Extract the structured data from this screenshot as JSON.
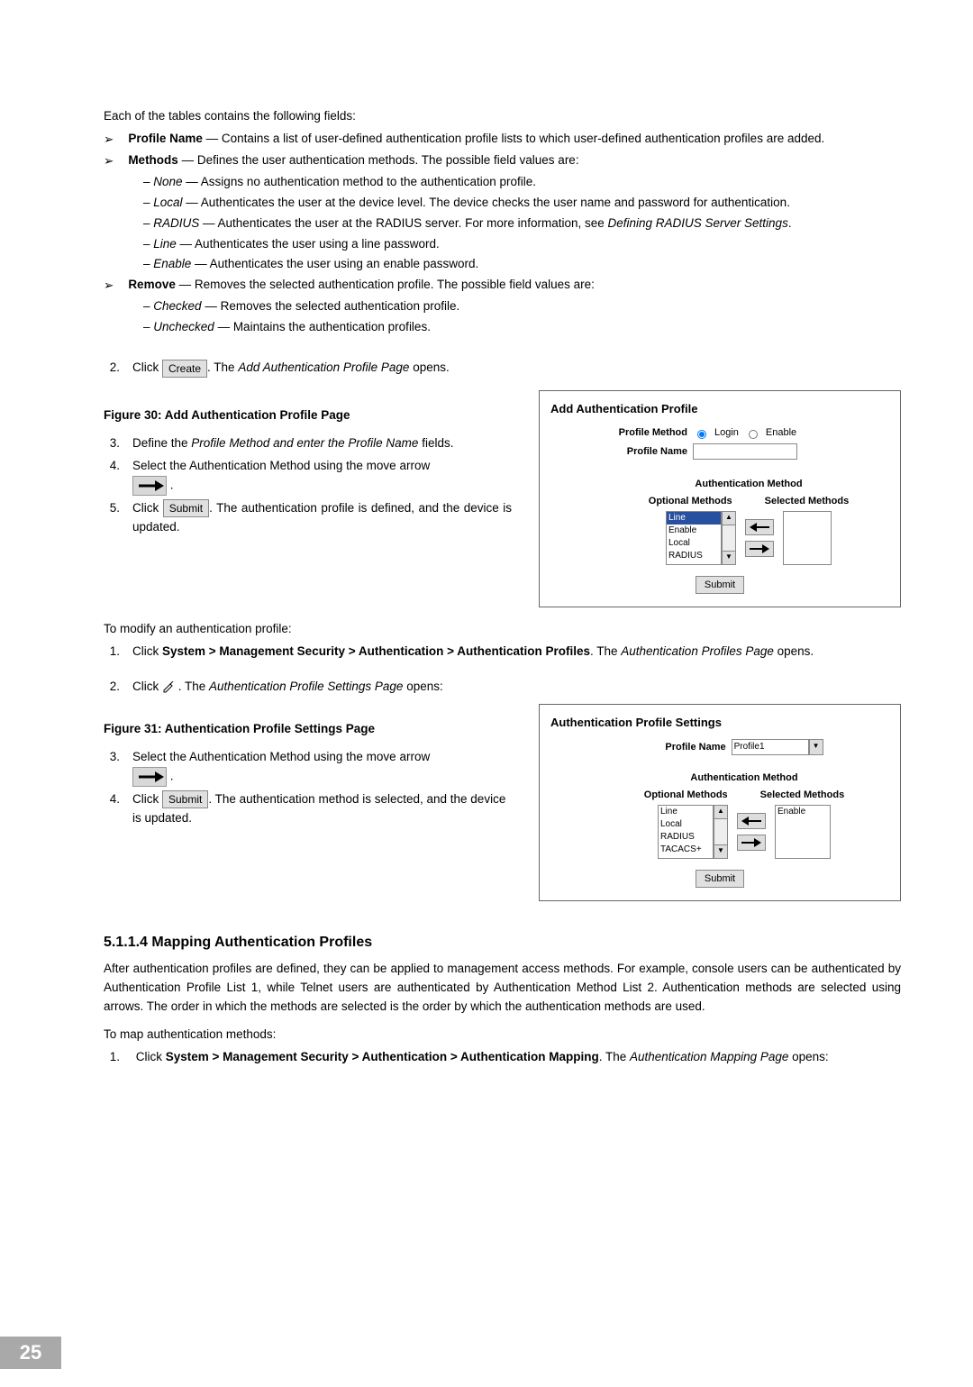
{
  "intro": "Each of the tables contains the following fields:",
  "bullets": {
    "profile_name": {
      "label": "Profile Name",
      "desc": " — Contains a list of user-defined authentication profile lists to which user-defined authentication profiles are added."
    },
    "methods": {
      "label": "Methods",
      "desc": " — Defines the user authentication methods. The possible field values are:"
    },
    "methods_sub": [
      {
        "em": "None",
        "rest": " — Assigns no authentication method to the authentication profile."
      },
      {
        "em": "Local",
        "rest": " — Authenticates the user at the device level. The device checks the user name and password for authentication."
      },
      {
        "em": "RADIUS",
        "rest": " — Authenticates the user at the RADIUS server. For more information, see ",
        "em2": "Defining RADIUS Server Settings",
        "tail": "."
      },
      {
        "em": "Line",
        "rest": " — Authenticates the user using a line password."
      },
      {
        "em": "Enable",
        "rest": " — Authenticates the user using an enable password."
      }
    ],
    "remove": {
      "label": "Remove",
      "desc": " — Removes the selected authentication profile. The possible field values are:"
    },
    "remove_sub": [
      {
        "em": "Checked",
        "rest": " — Removes the selected authentication profile."
      },
      {
        "em": "Unchecked",
        "rest": " — Maintains the authentication profiles."
      }
    ]
  },
  "step2": {
    "pre": "Click ",
    "btn": "Create",
    "post": ". The ",
    "em": "Add Authentication Profile Page",
    "tail": " opens."
  },
  "fig30_title": "Figure 30: Add Authentication Profile Page",
  "step3": "Define the ",
  "step3_em": "Profile Method and enter the Profile Name",
  "step3_tail": " fields.",
  "step4": "Select the Authentication Method using the move arrow ",
  "step5": {
    "pre": "Click ",
    "btn": "Submit",
    "post": ". The authentication profile is defined, and the device is updated."
  },
  "dlg1": {
    "title": "Add Authentication Profile",
    "profile_method_label": "Profile Method",
    "login": "Login",
    "enable": "Enable",
    "profile_name_label": "Profile Name",
    "auth_header": "Authentication Method",
    "optional": "Optional Methods",
    "selected": "Selected Methods",
    "opts": [
      "Line",
      "Enable",
      "Local",
      "RADIUS"
    ],
    "submit": "Submit"
  },
  "modify_intro": "To modify an authentication profile:",
  "m1": {
    "pre": "Click ",
    "bold": "System > Management Security > Authentication > Authentication Profiles",
    "post": ". The ",
    "em": "Authentication Profiles Page",
    "tail": " opens."
  },
  "m2": {
    "pre": "Click ",
    "post": " . The ",
    "em": "Authentication Profile Settings Page",
    "tail": " opens:"
  },
  "fig31_title": "Figure 31: Authentication Profile Settings Page",
  "s3": "Select the Authentication Method using the move arrow ",
  "s4": {
    "pre": "Click ",
    "btn": "Submit",
    "post": ". The authentication method is selected, and the device is updated."
  },
  "dlg2": {
    "title": "Authentication Profile Settings",
    "profile_name_label": "Profile Name",
    "profile_name_value": "Profile1",
    "auth_header": "Authentication Method",
    "optional": "Optional Methods",
    "selected": "Selected Methods",
    "opts": [
      "Line",
      "Local",
      "RADIUS",
      "TACACS+"
    ],
    "sel_opts": [
      "Enable"
    ],
    "submit": "Submit"
  },
  "section_head": "5.1.1.4   Mapping Authentication Profiles",
  "section_body": "After authentication profiles are defined, they can be applied to management access methods. For example, console users can be authenticated by Authentication Profile List 1, while Telnet users are authenticated by Authentication Method List 2. Authentication methods are selected using arrows. The order in which the methods are selected is the order by which the authentication methods are used.",
  "map_intro": "To map authentication methods:",
  "map1": {
    "pre": "Click ",
    "bold": "System > Management Security > Authentication > Authentication Mapping",
    "post": ". The ",
    "em": "Authentication Mapping Page",
    "tail": " opens:"
  },
  "pagenum": "25"
}
